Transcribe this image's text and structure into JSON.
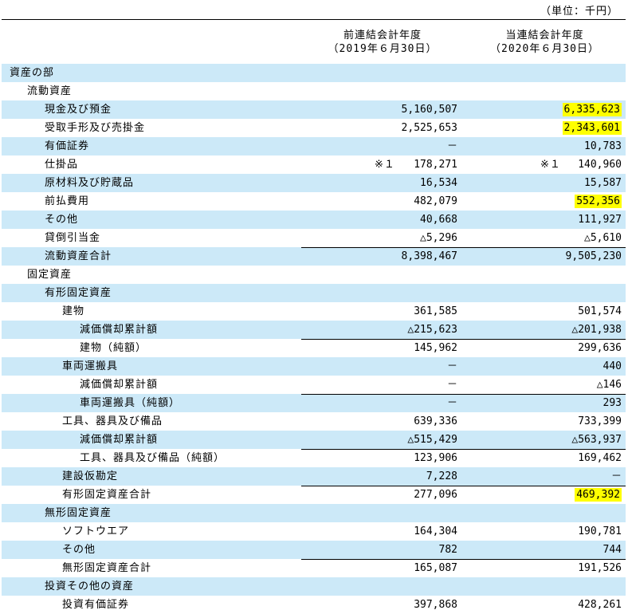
{
  "unit_label": "（単位：千円）",
  "header": {
    "col1_line1": "前連結会計年度",
    "col1_line2": "（2019年６月30日）",
    "col2_line1": "当連結会計年度",
    "col2_line2": "（2020年６月30日）"
  },
  "highlight_color": "#ffff00",
  "row_shade_color": "#cce9f8",
  "rows": [
    {
      "label": "資産の部",
      "prev": "",
      "curr": ""
    },
    {
      "label": "流動資産",
      "prev": "",
      "curr": ""
    },
    {
      "label": "現金及び預金",
      "prev": "5,160,507",
      "curr": "6,335,623",
      "curr_highlight": true
    },
    {
      "label": "受取手形及び売掛金",
      "prev": "2,525,653",
      "curr": "2,343,601",
      "curr_highlight": true
    },
    {
      "label": "有価証券",
      "prev": "－",
      "curr": "10,783"
    },
    {
      "label": "仕掛品",
      "prev": "178,271",
      "curr": "140,960",
      "prev_note": "※１",
      "curr_note": "※１"
    },
    {
      "label": "原材料及び貯蔵品",
      "prev": "16,534",
      "curr": "15,587"
    },
    {
      "label": "前払費用",
      "prev": "482,079",
      "curr": "552,356",
      "curr_highlight": true
    },
    {
      "label": "その他",
      "prev": "40,668",
      "curr": "111,927"
    },
    {
      "label": "貸倒引当金",
      "prev": "△5,296",
      "curr": "△5,610"
    },
    {
      "label": "流動資産合計",
      "prev": "8,398,467",
      "curr": "9,505,230",
      "total": true
    },
    {
      "label": "固定資産",
      "prev": "",
      "curr": ""
    },
    {
      "label": "有形固定資産",
      "prev": "",
      "curr": ""
    },
    {
      "label": "建物",
      "prev": "361,585",
      "curr": "501,574"
    },
    {
      "label": "減価償却累計額",
      "prev": "△215,623",
      "curr": "△201,938"
    },
    {
      "label": "建物（純額）",
      "prev": "145,962",
      "curr": "299,636",
      "total": true
    },
    {
      "label": "車両運搬具",
      "prev": "－",
      "curr": "440"
    },
    {
      "label": "減価償却累計額",
      "prev": "－",
      "curr": "△146"
    },
    {
      "label": "車両運搬具（純額）",
      "prev": "－",
      "curr": "293",
      "total": true
    },
    {
      "label": "工具、器具及び備品",
      "prev": "639,336",
      "curr": "733,399"
    },
    {
      "label": "減価償却累計額",
      "prev": "△515,429",
      "curr": "△563,937"
    },
    {
      "label": "工具、器具及び備品（純額）",
      "prev": "123,906",
      "curr": "169,462",
      "total": true
    },
    {
      "label": "建設仮勘定",
      "prev": "7,228",
      "curr": "－"
    },
    {
      "label": "有形固定資産合計",
      "prev": "277,096",
      "curr": "469,392",
      "total": true,
      "curr_highlight": true
    },
    {
      "label": "無形固定資産",
      "prev": "",
      "curr": ""
    },
    {
      "label": "ソフトウエア",
      "prev": "164,304",
      "curr": "190,781"
    },
    {
      "label": "その他",
      "prev": "782",
      "curr": "744"
    },
    {
      "label": "無形固定資産合計",
      "prev": "165,087",
      "curr": "191,526",
      "total": true
    },
    {
      "label": "投資その他の資産",
      "prev": "",
      "curr": ""
    },
    {
      "label": "投資有価証券",
      "prev": "397,868",
      "curr": "428,261"
    }
  ]
}
